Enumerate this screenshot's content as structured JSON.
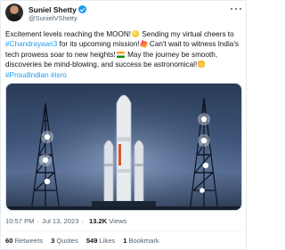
{
  "author": {
    "display_name": "Suniel Shetty",
    "handle": "@SunielVShetty"
  },
  "tweet": {
    "part1": "Excitement levels reaching the MOON!",
    "part2": " Sending my virtual cheers to ",
    "hashtag_chandrayaan": "#Chandrayaan3",
    "part3": " for its upcoming mission!",
    "part4": " Can't wait to witness India's tech prowess soar to new heights!",
    "part5": " May the journey be smooth, discoveries be mind-blowing, and success be astronomical!",
    "hashtag_proud": "#ProudIndian",
    "hashtag_isro": "#isro"
  },
  "meta": {
    "time": "10:57 PM",
    "date": "Jul 13, 2023",
    "views_count": "13.2K",
    "views_label": "Views"
  },
  "stats": {
    "retweets_count": "60",
    "retweets_label": "Retweets",
    "quotes_count": "3",
    "quotes_label": "Quotes",
    "likes_count": "549",
    "likes_label": "Likes",
    "bookmarks_count": "1",
    "bookmarks_label": "Bookmark"
  },
  "colors": {
    "link": "#1d9bf0",
    "text": "#0f1419",
    "secondary": "#536471"
  },
  "icons": [
    "verified-badge-icon",
    "more-options-icon"
  ]
}
